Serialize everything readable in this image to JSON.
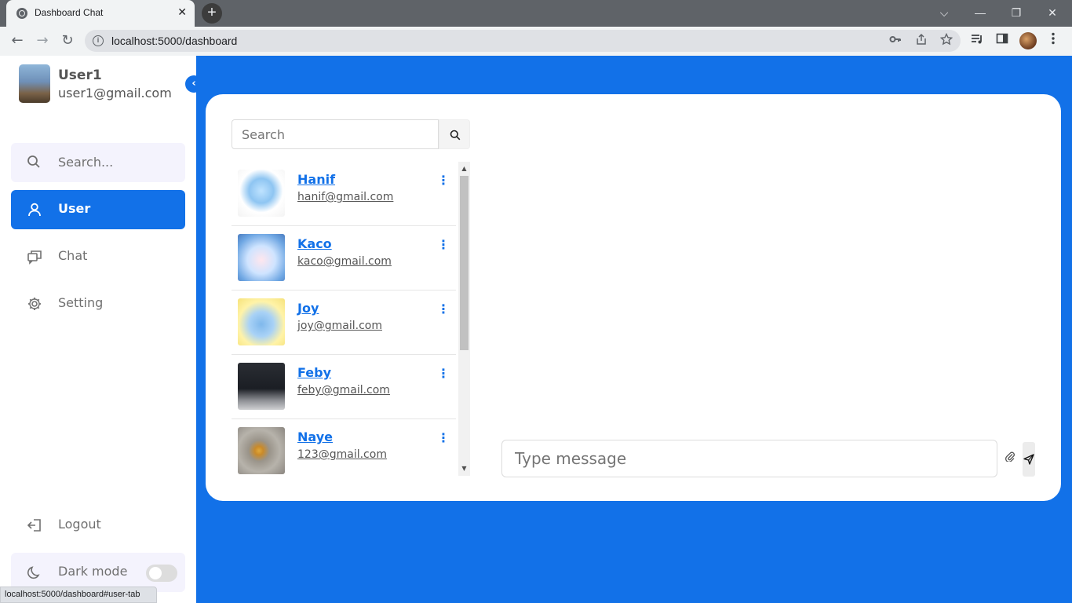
{
  "browser": {
    "tab_title": "Dashboard Chat",
    "tab_close": "✕",
    "new_tab": "+",
    "url": "localhost:5000/dashboard",
    "status_url": "localhost:5000/dashboard#user-tab",
    "window": {
      "tabs_menu": "⌵",
      "minimize": "—",
      "restore": "❐",
      "close": "✕"
    },
    "nav": {
      "back": "←",
      "forward": "→",
      "reload": "↻"
    }
  },
  "sidebar": {
    "user_name": "User1",
    "user_email": "user1@gmail.com",
    "collapse": "‹",
    "search_label": "Search...",
    "items": [
      {
        "label": "User",
        "active": true
      },
      {
        "label": "Chat",
        "active": false
      },
      {
        "label": "Setting",
        "active": false
      }
    ],
    "logout_label": "Logout",
    "dark_mode_label": "Dark mode",
    "dark_mode_on": false
  },
  "contacts_panel": {
    "search_placeholder": "Search",
    "contacts": [
      {
        "name": "Hanif",
        "email": "hanif@gmail.com"
      },
      {
        "name": "Kaco",
        "email": "kaco@gmail.com"
      },
      {
        "name": "Joy",
        "email": "joy@gmail.com"
      },
      {
        "name": "Feby",
        "email": "feby@gmail.com"
      },
      {
        "name": "Naye",
        "email": "123@gmail.com"
      }
    ],
    "menu_glyph": "⋮"
  },
  "chat": {
    "message_placeholder": "Type message",
    "attach_glyph": "⊘"
  },
  "colors": {
    "accent": "#1271e8",
    "sidebar_search_bg": "#f4f3fd",
    "text_gray": "#707070"
  }
}
